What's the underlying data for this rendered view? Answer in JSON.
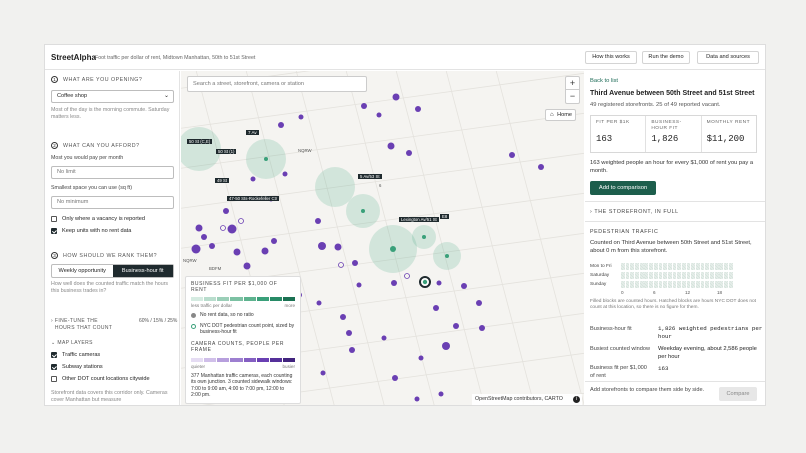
{
  "header": {
    "brand": "StreetAlpha",
    "subtitle": "Foot traffic per dollar of rent, Midtown Manhattan, 50th to 51st Street",
    "buttons": [
      "How this works",
      "Run the demo",
      "Data and sources"
    ]
  },
  "sidebar": {
    "q1": {
      "num": "1",
      "label": "WHAT ARE YOU OPENING?",
      "value": "Coffee shop",
      "help": "Most of the day is the morning commute. Saturday matters less."
    },
    "q2": {
      "num": "2",
      "label": "WHAT CAN YOU AFFORD?",
      "rent_label": "Most you would pay per month",
      "rent_placeholder": "No limit",
      "space_label": "Smallest space you can use (sq ft)",
      "space_placeholder": "No minimum",
      "vacancy_label": "Only where a vacancy is reported",
      "vacancy_checked": false,
      "rentdata_label": "Keep units with no rent data",
      "rentdata_checked": true
    },
    "q3": {
      "num": "3",
      "label": "HOW SHOULD WE RANK THEM?",
      "options": [
        "Weekly opportunity",
        "Business-hour fit"
      ],
      "selected": "Business-hour fit",
      "help": "How well does the counted traffic match the hours this business trades in?"
    },
    "fine_tune": {
      "label": "FINE-TUNE THE HOURS THAT COUNT",
      "value": "60% / 15% / 25%",
      "arrow": "›"
    },
    "map_layers": {
      "label": "MAP LAYERS",
      "arrow": "⌄",
      "items": [
        {
          "label": "Traffic cameras",
          "checked": true
        },
        {
          "label": "Subway stations",
          "checked": true
        },
        {
          "label": "Other DOT count locations citywide",
          "checked": false
        }
      ],
      "note": "Storefront data covers this corridor only. Cameras cover Manhattan but measure"
    }
  },
  "map": {
    "search_placeholder": "Search a street, storefront, camera or station",
    "zoom_in": "+",
    "zoom_out": "−",
    "home_label": "Home",
    "station_labels": [
      "7 Av",
      "50 St (C,E)",
      "49 St",
      "50 St (1)",
      "47-50 Sts-Rockefeller Ctr",
      "5 Av/53 St",
      "Lexington Av/51 St",
      "E8",
      "NQRW",
      "BDFM",
      "NQRW",
      "6"
    ],
    "attribution": "OpenStreetMap contributors, CARTO",
    "legend": {
      "title": "BUSINESS FIT PER $1,000 OF RENT",
      "low": "less traffic per dollar",
      "high": "more",
      "no_rent": "No rent data, so no ratio",
      "dot_label": "NYC DOT pedestrian count point, sized by business-hour fit",
      "cam_title": "CAMERA COUNTS, PEOPLE PER FRAME",
      "cam_low": "quieter",
      "cam_high": "busier",
      "cam_note": "377 Manhattan traffic cameras, each counting its own junction. 3 counted sidewalk windows: 7:00 to 9:00 am, 4:00 to 7:00 pm, 12:00 to 2:00 pm."
    }
  },
  "detail": {
    "back": "Back to list",
    "title": "Third Avenue between 50th Street and 51st Street",
    "subtitle": "49 registered storefronts. 25 of 49 reported vacant.",
    "stats": [
      {
        "label": "FIT PER $1K",
        "value": "163"
      },
      {
        "label": "BUSINESS-HOUR FIT",
        "value": "1,826"
      },
      {
        "label": "MONTHLY RENT",
        "value": "$11,200"
      }
    ],
    "summary": "163 weighted people an hour for every $1,000 of rent you pay a month.",
    "add_button": "Add to comparison",
    "storefront_section": "THE STOREFRONT, IN FULL",
    "ped_section": "PEDESTRIAN TRAFFIC",
    "ped_text": "Counted on Third Avenue between 50th Street and 51st Street, about 0 m from this storefront.",
    "rows": [
      "Mon to Fri",
      "Saturday",
      "Sunday"
    ],
    "hour_ticks": [
      "0",
      "6",
      "12",
      "18"
    ],
    "grid_note": "Filled blocks are counted hours. Hatched blocks are hours NYC DOT does not count at this location, so there is no figure for them.",
    "kv": [
      {
        "k": "Business-hour fit",
        "v": "1,826 weighted pedestrians per hour"
      },
      {
        "k": "Busiest counted window",
        "v": "Weekday evening, about 2,586 people per hour"
      },
      {
        "k": "Business fit per $1,000 of rent",
        "v": "163"
      }
    ],
    "footer_text": "Add storefronts to compare them side by side.",
    "compare_button": "Compare"
  },
  "colors": {
    "accent": "#1d5e4c",
    "dark": "#1f2a2e",
    "purple": "#6a3fb3",
    "green": "#3aa07a"
  }
}
